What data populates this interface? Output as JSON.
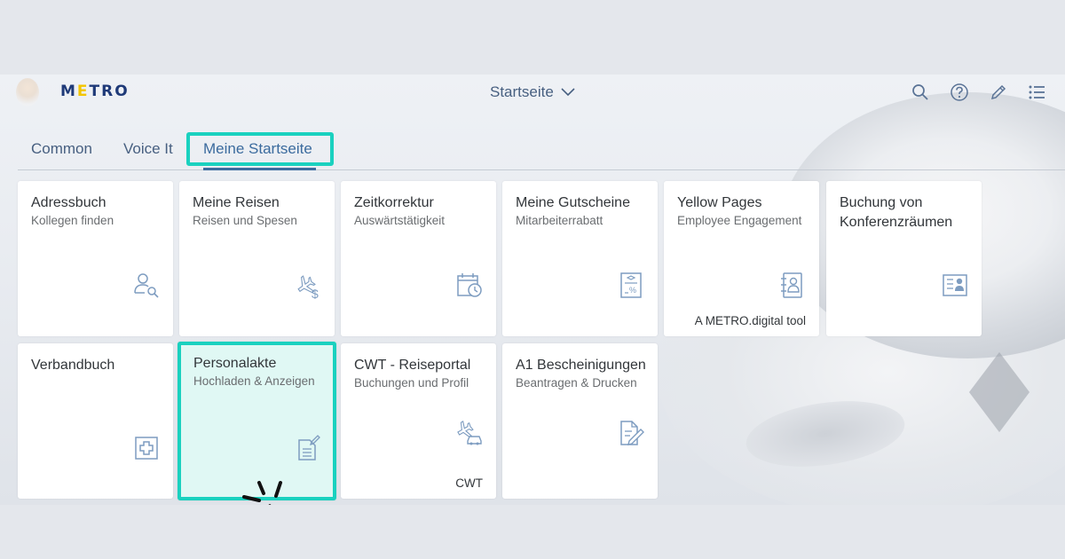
{
  "header": {
    "logo": {
      "before": "M",
      "accent": "E",
      "after": "TRO"
    },
    "page_title": "Startseite",
    "icons": [
      "search-icon",
      "help-icon",
      "edit-icon",
      "menu-list-icon"
    ]
  },
  "tabs": [
    {
      "label": "Common",
      "active": false
    },
    {
      "label": "Voice It",
      "active": false
    },
    {
      "label": "Meine Startseite",
      "active": true
    }
  ],
  "tiles": [
    {
      "title": "Adressbuch",
      "subtitle": "Kollegen finden",
      "icon": "person-search-icon",
      "footer": ""
    },
    {
      "title": "Meine Reisen",
      "subtitle": "Reisen und Spesen",
      "icon": "travel-expense-icon",
      "footer": ""
    },
    {
      "title": "Zeitkorrektur",
      "subtitle": "Auswärtstätigkeit",
      "icon": "calendar-clock-icon",
      "footer": ""
    },
    {
      "title": "Meine Gutscheine",
      "subtitle": "Mitarbeiterrabatt",
      "icon": "voucher-icon",
      "footer": ""
    },
    {
      "title": "Yellow Pages",
      "subtitle": "Employee Engagement",
      "icon": "address-book-icon",
      "footer": "A METRO.digital tool"
    },
    {
      "title": "Buchung von Konferenzräumen",
      "subtitle": "",
      "icon": "contact-card-icon",
      "footer": ""
    },
    {
      "title": "Verbandbuch",
      "subtitle": "",
      "icon": "first-aid-icon",
      "footer": ""
    },
    {
      "title": "Personalakte",
      "subtitle": "Hochladen & Anzeigen",
      "icon": "document-edit-icon",
      "footer": ""
    },
    {
      "title": "CWT - Reiseportal",
      "subtitle": "Buchungen und Profil",
      "icon": "flight-car-icon",
      "footer": "CWT"
    },
    {
      "title": "A1 Bescheinigungen",
      "subtitle": "Beantragen & Drucken",
      "icon": "form-edit-icon",
      "footer": ""
    }
  ],
  "colors": {
    "highlight": "#1ad1bf",
    "highlight_fill": "#e0f8f4",
    "brand_blue": "#1f3a78",
    "brand_yellow": "#f3c500",
    "icon_blue": "#7d9cc0"
  }
}
